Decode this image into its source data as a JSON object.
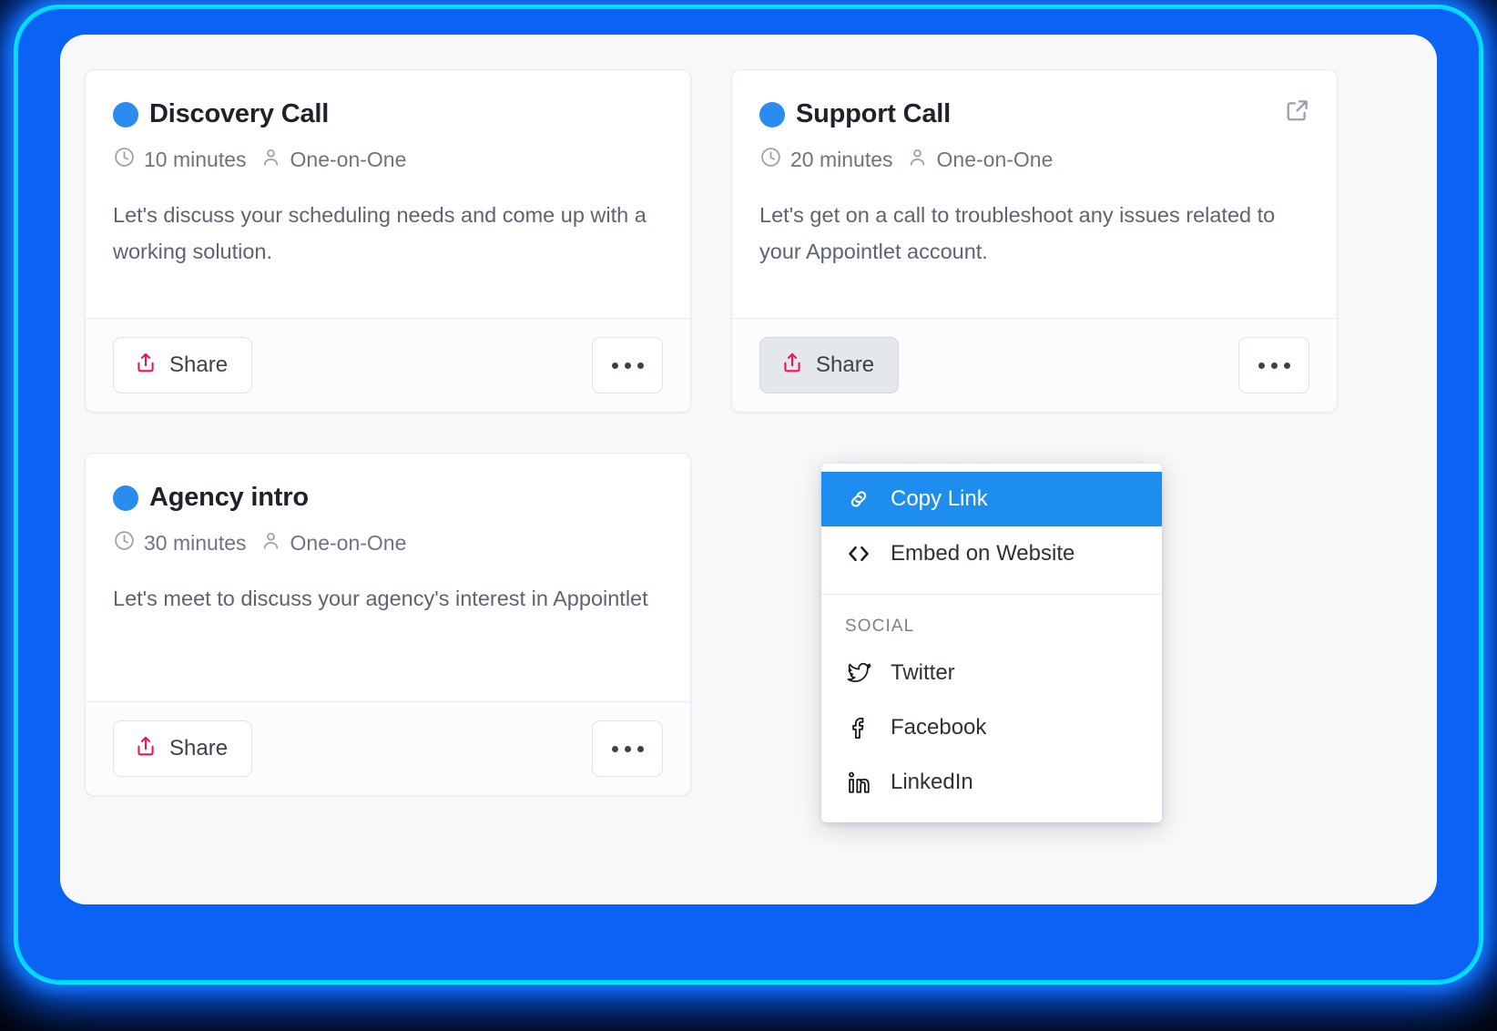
{
  "window": {
    "background_color": "#f7f8fa",
    "glow_color": "#0b63f6",
    "accent_blue": "#2b8cf0",
    "share_icon_color": "#ec1457"
  },
  "cards": [
    {
      "title": "Discovery Call",
      "dot_color": "#2b8cf0",
      "duration": "10 minutes",
      "type": "One-on-One",
      "description": "Let's discuss your scheduling needs and come up with a working solution.",
      "share_label": "Share",
      "share_active": false,
      "has_external_link": false
    },
    {
      "title": "Support Call",
      "dot_color": "#2b8cf0",
      "duration": "20 minutes",
      "type": "One-on-One",
      "description": "Let's get on a call to troubleshoot any issues related to your Appointlet account.",
      "share_label": "Share",
      "share_active": true,
      "has_external_link": true
    },
    {
      "title": "Agency intro",
      "dot_color": "#2b8cf0",
      "duration": "30 minutes",
      "type": "One-on-One",
      "description": "Let's meet to discuss your agency's interest in Appointlet",
      "share_label": "Share",
      "share_active": false,
      "has_external_link": false
    }
  ],
  "share_menu": {
    "items": [
      {
        "label": "Copy Link",
        "icon": "link-icon",
        "highlighted": true
      },
      {
        "label": "Embed on Website",
        "icon": "code-brackets-icon",
        "highlighted": false
      }
    ],
    "section_label": "SOCIAL",
    "social": [
      {
        "label": "Twitter",
        "icon": "twitter-icon"
      },
      {
        "label": "Facebook",
        "icon": "facebook-icon"
      },
      {
        "label": "LinkedIn",
        "icon": "linkedin-icon"
      }
    ],
    "highlight_color": "#1d8ef0"
  },
  "icons": {
    "clock": "clock-icon",
    "person": "person-icon",
    "share": "share-upload-icon",
    "kebab": "more-options-icon",
    "external": "external-link-icon"
  }
}
